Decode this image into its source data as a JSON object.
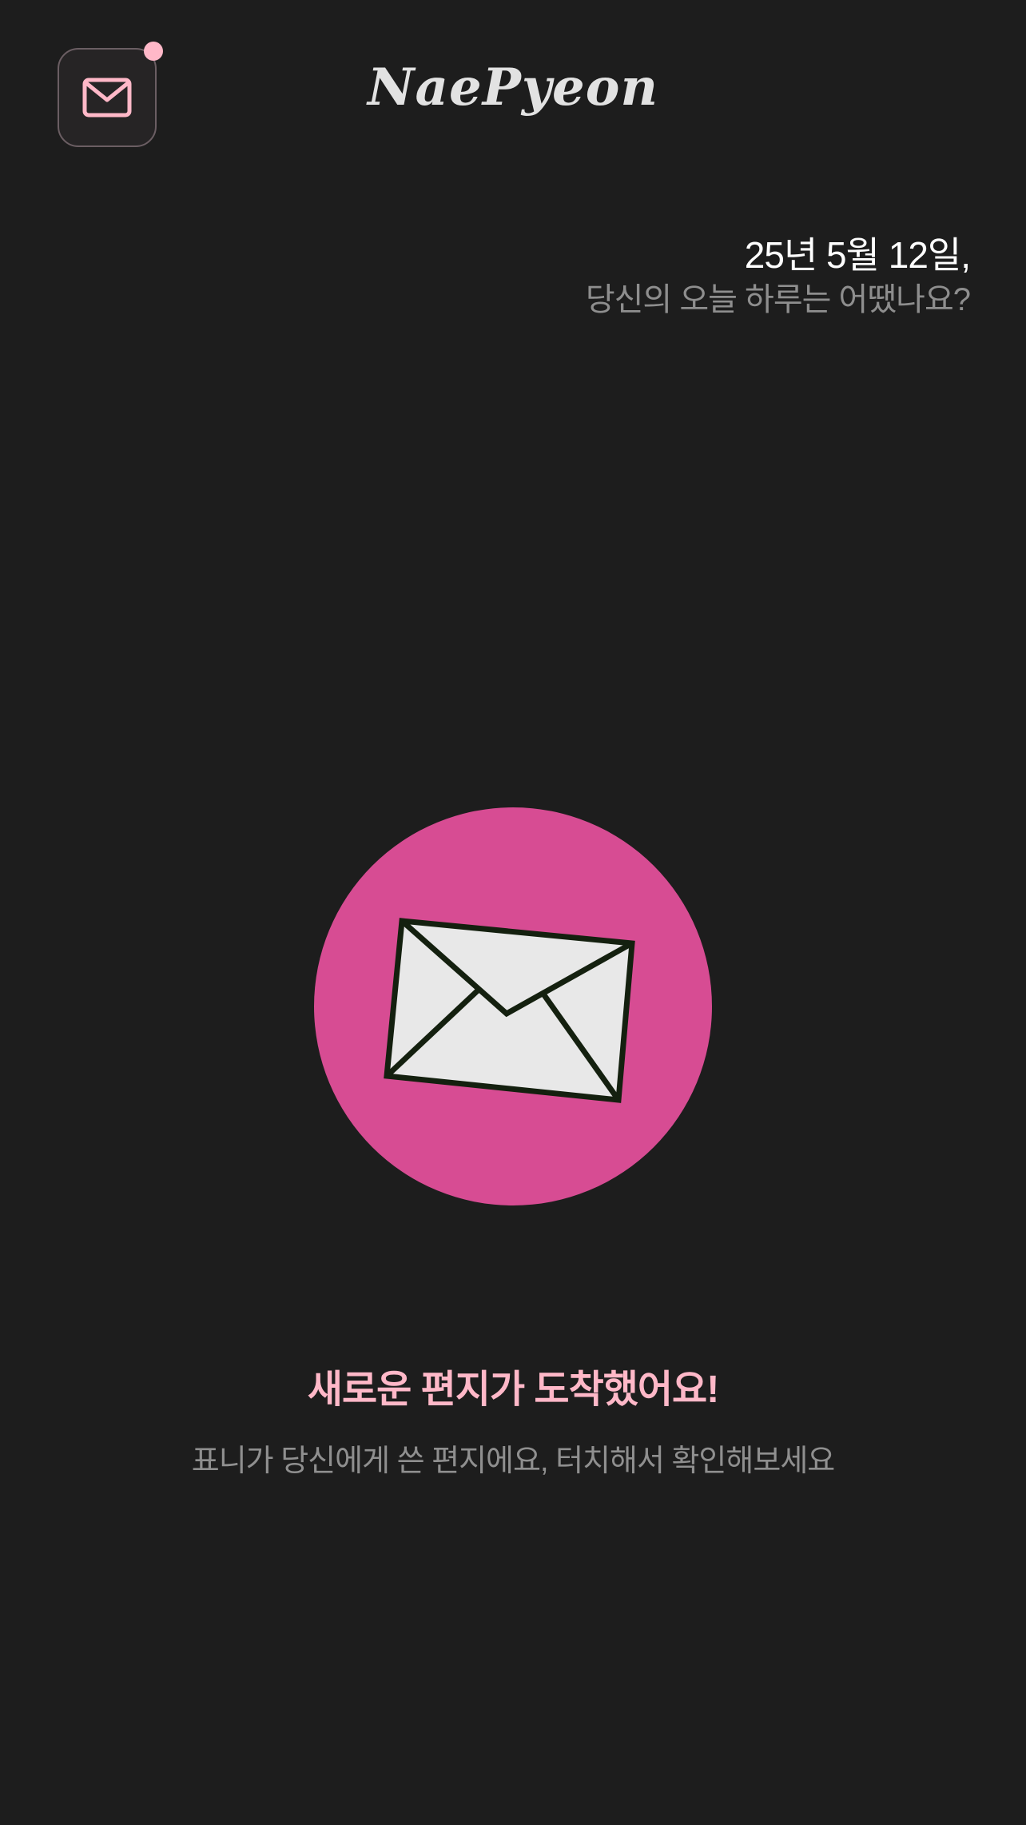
{
  "app": {
    "title": "NaePyeon"
  },
  "header": {
    "mailbox_icon": "mail-icon",
    "has_notification": true
  },
  "greeting": {
    "date": "25년 5월 12일,",
    "question": "당신의 오늘 하루는 어땠나요?"
  },
  "letter": {
    "icon": "envelope-icon",
    "title": "새로운 편지가 도착했어요!",
    "subtitle": "표니가 당신에게 쓴 편지에요, 터치해서 확인해보세요"
  },
  "colors": {
    "background": "#1d1d1d",
    "accent_pink": "#ffb8c8",
    "circle_pink": "#d74c93",
    "envelope_fill": "#e8e8e8",
    "envelope_stroke": "#14200f"
  }
}
